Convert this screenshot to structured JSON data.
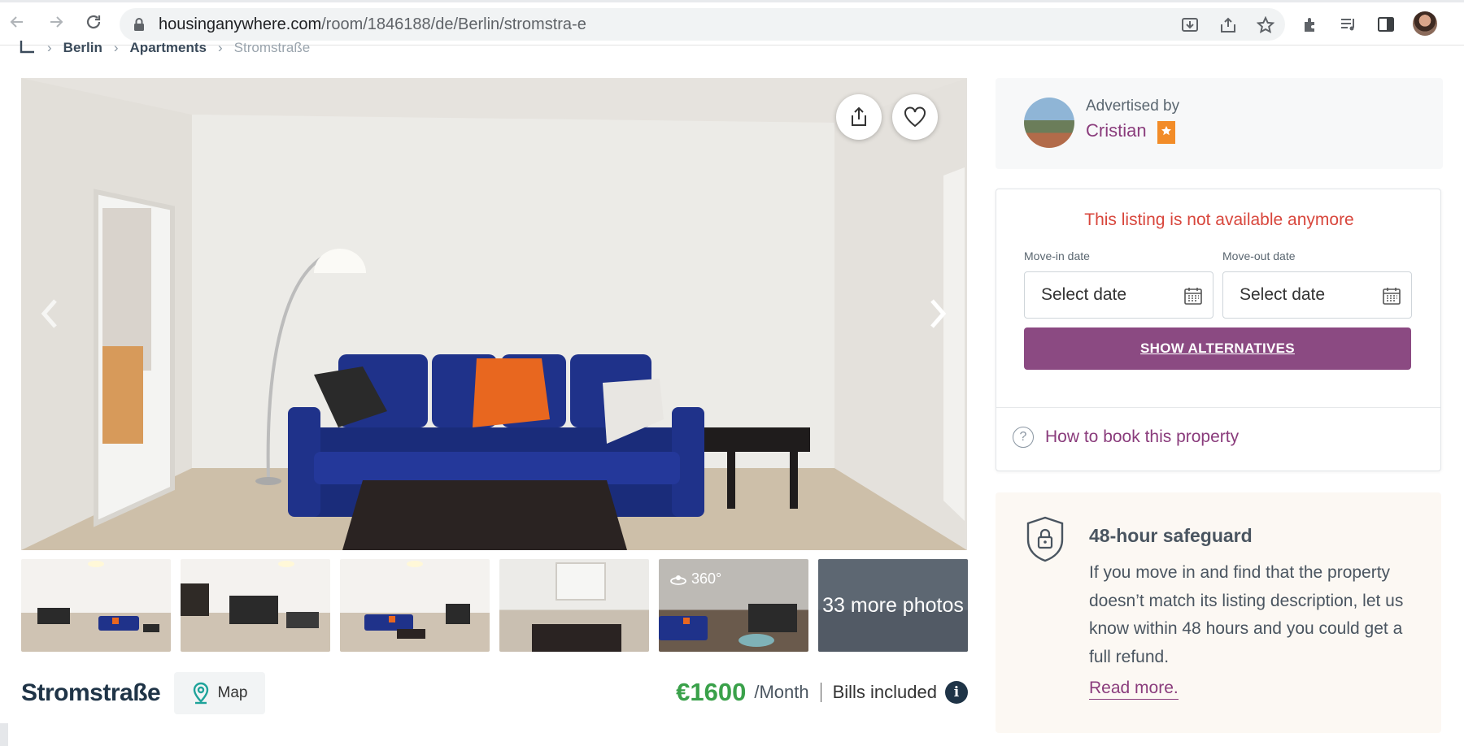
{
  "browser": {
    "url_host": "housinganywhere.com",
    "url_path": "/room/1846188/de/Berlin/stromstra-e",
    "icons": [
      "back-icon",
      "forward-icon",
      "reload-icon",
      "lock-icon",
      "install-app-icon",
      "share-icon",
      "bookmark-star-icon",
      "extensions-icon",
      "reading-list-icon",
      "side-panel-icon",
      "profile-avatar"
    ]
  },
  "breadcrumb": {
    "items": [
      "Berlin",
      "Apartments"
    ],
    "current": "Stromstraße"
  },
  "gallery": {
    "thumbnail_360_label": "360°",
    "more_photos_label": "33 more photos"
  },
  "listing": {
    "title": "Stromstraße",
    "map_label": "Map",
    "price": "€1600",
    "price_period": "/Month",
    "bills_label": "Bills included",
    "info_glyph": "i"
  },
  "advertiser": {
    "label": "Advertised by",
    "name": "Cristian"
  },
  "booking": {
    "unavailable_message": "This listing is not available anymore",
    "move_in_label": "Move-in date",
    "move_in_value": "Select date",
    "move_out_label": "Move-out date",
    "move_out_value": "Select date",
    "show_alternatives_label": "SHOW ALTERNATIVES",
    "how_to_book_label": "How to book this property",
    "help_glyph": "?"
  },
  "safeguard": {
    "title": "48-hour safeguard",
    "body": "If you move in and find that the property doesn’t match its listing description, let us know within 48 hours and you could get a full refund.",
    "link_label": "Read more."
  },
  "colors": {
    "brand_purple": "#8b4a82",
    "alert_red": "#d8463c",
    "price_green": "#3aa14a",
    "navy": "#1f3447",
    "badge_orange": "#f28c28"
  }
}
